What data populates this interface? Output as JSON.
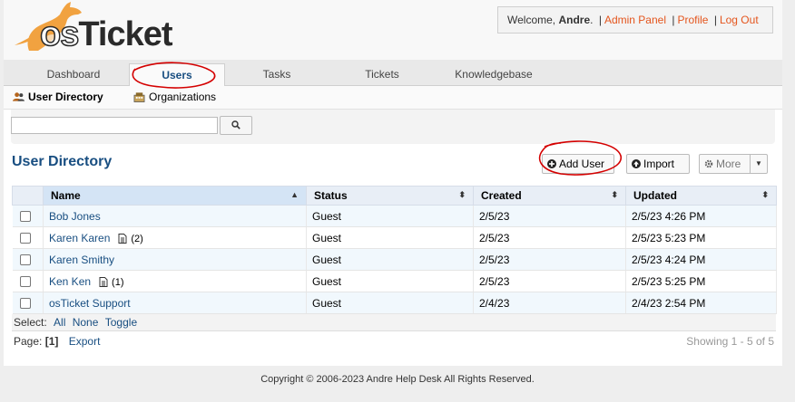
{
  "header": {
    "logo_text_os": "os",
    "logo_text_ticket": "Ticket",
    "welcome_prefix": "Welcome, ",
    "username": "Andre",
    "welcome_suffix": ".",
    "links": {
      "admin_panel": "Admin Panel",
      "profile": "Profile",
      "log_out": "Log Out"
    },
    "separator": "|"
  },
  "nav": {
    "tabs": [
      {
        "label": "Dashboard",
        "active": false
      },
      {
        "label": "Users",
        "active": true
      },
      {
        "label": "Tasks",
        "active": false
      },
      {
        "label": "Tickets",
        "active": false
      },
      {
        "label": "Knowledgebase",
        "active": false
      }
    ]
  },
  "subnav": {
    "items": [
      {
        "label": "User Directory",
        "icon": "users-icon",
        "active": true
      },
      {
        "label": "Organizations",
        "icon": "building-icon",
        "active": false
      }
    ]
  },
  "search": {
    "value": "",
    "placeholder": "",
    "button_icon": "search-icon"
  },
  "page_title": "User Directory",
  "actions": {
    "add_user": "Add User",
    "import": "Import",
    "more": "More"
  },
  "table": {
    "columns": [
      "Name",
      "Status",
      "Created",
      "Updated"
    ],
    "rows": [
      {
        "name": "Bob Jones",
        "notes": "",
        "status": "Guest",
        "created": "2/5/23",
        "updated": "2/5/23 4:26 PM"
      },
      {
        "name": "Karen Karen",
        "notes": "(2)",
        "status": "Guest",
        "created": "2/5/23",
        "updated": "2/5/23 5:23 PM"
      },
      {
        "name": "Karen Smithy",
        "notes": "",
        "status": "Guest",
        "created": "2/5/23",
        "updated": "2/5/23 4:24 PM"
      },
      {
        "name": "Ken Ken",
        "notes": "(1)",
        "status": "Guest",
        "created": "2/5/23",
        "updated": "2/5/23 5:25 PM"
      },
      {
        "name": "osTicket Support",
        "notes": "",
        "status": "Guest",
        "created": "2/4/23",
        "updated": "2/4/23 2:54 PM"
      }
    ]
  },
  "select": {
    "label": "Select:",
    "all": "All",
    "none": "None",
    "toggle": "Toggle"
  },
  "pagination": {
    "label": "Page:",
    "current": "[1]",
    "export": "Export",
    "showing": "Showing 1 - 5 of 5"
  },
  "footer": "Copyright © 2006-2023 Andre Help Desk All Rights Reserved.",
  "colors": {
    "accent_blue": "#184e81",
    "link_orange": "#e4551d",
    "logo_orange": "#f1a240",
    "annotation_red": "#d40000"
  }
}
